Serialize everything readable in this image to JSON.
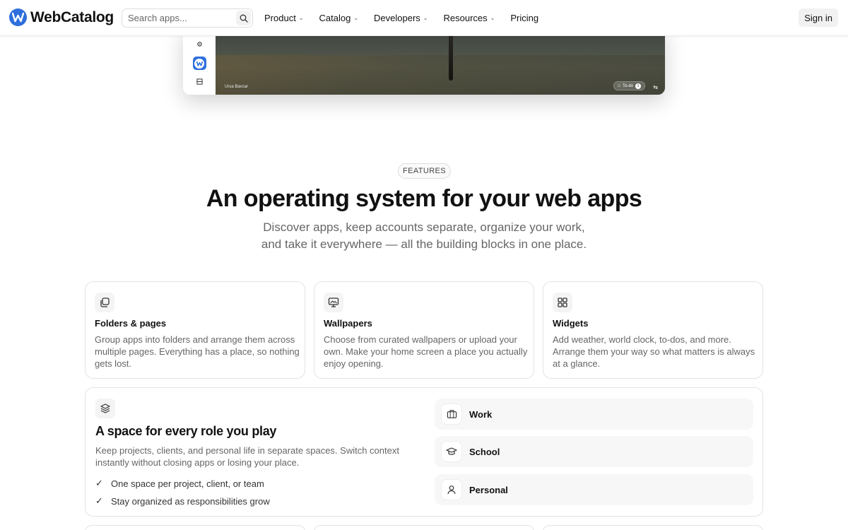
{
  "nav": {
    "brand": "WebCatalog",
    "search_placeholder": "Search apps...",
    "items": [
      {
        "label": "Product",
        "has_menu": true
      },
      {
        "label": "Catalog",
        "has_menu": true
      },
      {
        "label": "Developers",
        "has_menu": true
      },
      {
        "label": "Resources",
        "has_menu": true
      },
      {
        "label": "Pricing",
        "has_menu": false
      }
    ],
    "signin_label": "Sign in"
  },
  "preview": {
    "photo_credit": "Ursa Bavcar",
    "todo_label": "To-do",
    "todo_count": "1"
  },
  "features": {
    "pill": "FEATURES",
    "headline": "An operating system for your web apps",
    "subline": "Discover apps, keep accounts separate, organize your work, and take it everywhere — all the building blocks in one place."
  },
  "cards": [
    {
      "icon": "pages-icon",
      "title": "Folders & pages",
      "text": "Group apps into folders and arrange them across multiple pages. Everything has a place, so nothing gets lost."
    },
    {
      "icon": "wallpaper-icon",
      "title": "Wallpapers",
      "text": "Choose from curated wallpapers or upload your own. Make your home screen a place you actually enjoy opening."
    },
    {
      "icon": "widgets-icon",
      "title": "Widgets",
      "text": "Add weather, world clock, to-dos, and more. Arrange them your way so what matters is always at a glance."
    }
  ],
  "spaces_card": {
    "icon": "layers-icon",
    "title": "A space for every role you play",
    "text": "Keep projects, clients, and personal life in separate spaces. Switch context instantly without closing apps or losing your place.",
    "checks": [
      "One space per project, client, or team",
      "Stay organized as responsibilities grow"
    ],
    "spaces": [
      {
        "icon": "briefcase-icon",
        "label": "Work"
      },
      {
        "icon": "graduation-cap-icon",
        "label": "School"
      },
      {
        "icon": "person-icon",
        "label": "Personal"
      }
    ]
  },
  "colors": {
    "brand": "#2f6fdc",
    "muted_text": "#666666",
    "border": "#e3e3e3"
  }
}
